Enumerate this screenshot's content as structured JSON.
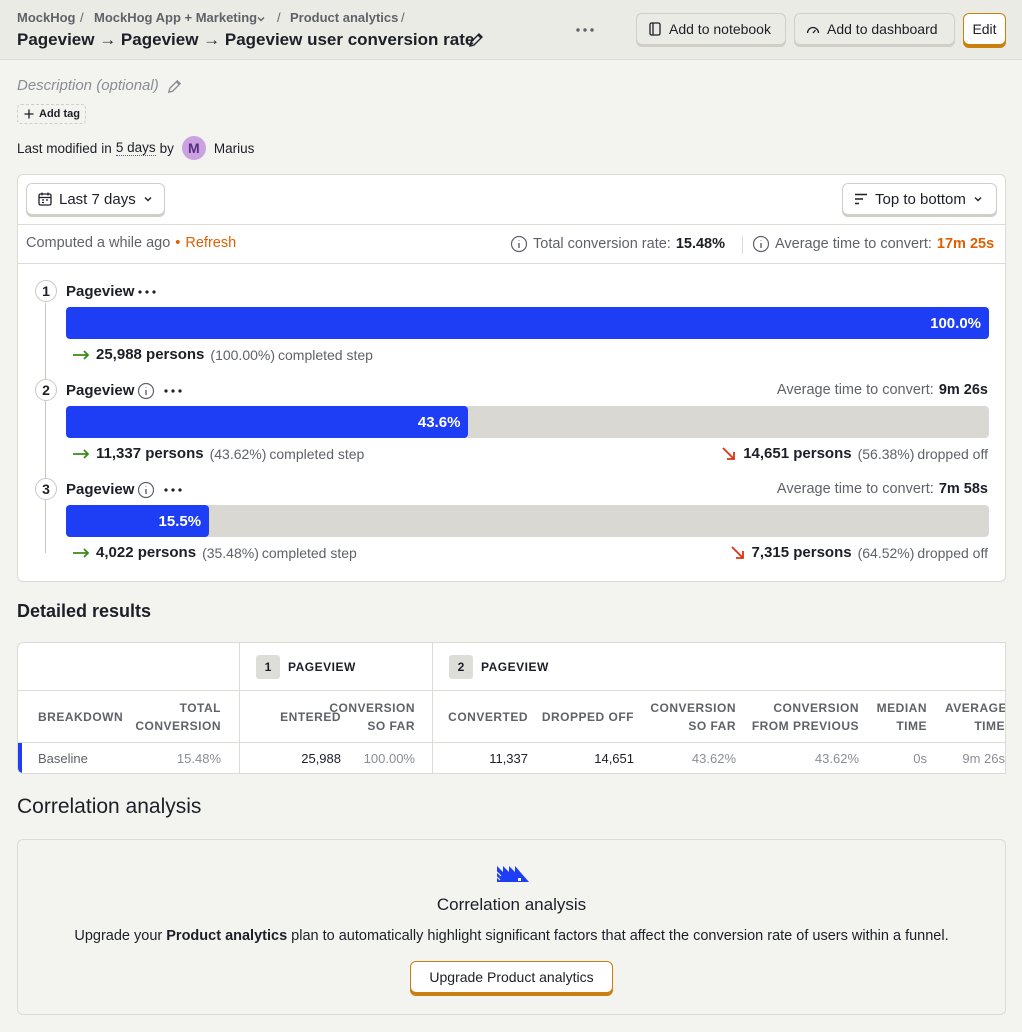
{
  "breadcrumbs": [
    "MockHog",
    "MockHog App + Marketing",
    "Product analytics"
  ],
  "title": "Pageview → Pageview → Pageview user conversion rate",
  "actions": {
    "notebook": "Add to notebook",
    "dashboard": "Add to dashboard",
    "edit": "Edit"
  },
  "description_placeholder": "Description (optional)",
  "add_tag": "Add tag",
  "modified": {
    "prefix": "Last modified",
    "in": "in",
    "when": "5 days",
    "by": "by",
    "avatar": "M",
    "user": "Marius"
  },
  "filters": {
    "date_range": "Last 7 days",
    "layout": "Top to bottom"
  },
  "summary": {
    "computed": "Computed a while ago",
    "bullet": "•",
    "refresh": "Refresh",
    "total_rate_label": "Total conversion rate:",
    "total_rate": "15.48%",
    "avg_time_label": "Average time to convert:",
    "avg_time": "17m 25s"
  },
  "steps": [
    {
      "num": "1",
      "name": "Pageview",
      "percent": 100.0,
      "bar_label": "100.0%",
      "completed_count": "25,988 persons",
      "completed_pct": "(100.00%)",
      "completed_text": "completed step"
    },
    {
      "num": "2",
      "name": "Pageview",
      "percent": 43.6,
      "bar_label": "43.6%",
      "avg_label": "Average time to convert:",
      "avg_time": "9m 26s",
      "completed_count": "11,337 persons",
      "completed_pct": "(43.62%)",
      "completed_text": "completed step",
      "dropped_count": "14,651 persons",
      "dropped_pct": "(56.38%)",
      "dropped_text": "dropped off"
    },
    {
      "num": "3",
      "name": "Pageview",
      "percent": 15.5,
      "bar_label": "15.5%",
      "avg_label": "Average time to convert:",
      "avg_time": "7m 58s",
      "completed_count": "4,022 persons",
      "completed_pct": "(35.48%)",
      "completed_text": "completed step",
      "dropped_count": "7,315 persons",
      "dropped_pct": "(64.52%)",
      "dropped_text": "dropped off"
    }
  ],
  "detailed": {
    "heading": "Detailed results",
    "groups": [
      {
        "num": "1",
        "label": "PAGEVIEW"
      },
      {
        "num": "2",
        "label": "PAGEVIEW"
      }
    ],
    "columns": [
      "BREAKDOWN",
      "TOTAL CONVERSION",
      "ENTERED",
      "CONVERSION SO FAR",
      "CONVERTED",
      "DROPPED OFF",
      "CONVERSION SO FAR",
      "CONVERSION FROM PREVIOUS",
      "MEDIAN TIME",
      "AVERAGE TIME"
    ],
    "rows": [
      [
        "Baseline",
        "15.48%",
        "25,988",
        "100.00%",
        "11,337",
        "14,651",
        "43.62%",
        "43.62%",
        "0s",
        "9m 26s"
      ]
    ]
  },
  "correlation": {
    "heading": "Correlation analysis",
    "card_title": "Correlation analysis",
    "desc_pre": "Upgrade your",
    "desc_bold": "Product analytics",
    "desc_post": "plan to automatically highlight significant factors that affect the conversion rate of users within a funnel.",
    "button": "Upgrade Product analytics"
  },
  "colors": {
    "bar": "#1e3ef5",
    "accent": "#e15f00",
    "green": "#3a8a1a",
    "drop": "#e0320e"
  }
}
